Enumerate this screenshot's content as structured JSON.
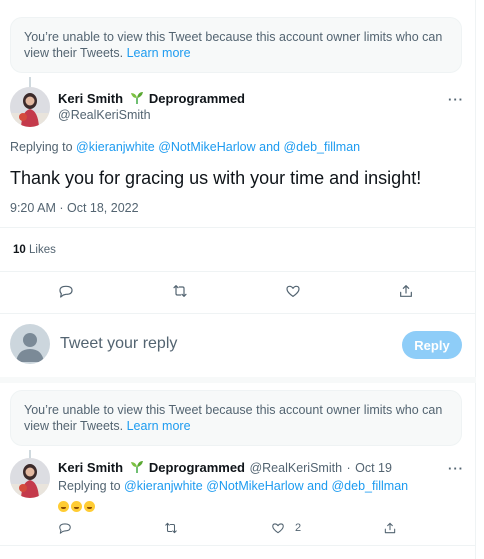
{
  "top_notice": {
    "text": "You’re unable to view this Tweet because this account owner limits who can view their Tweets.",
    "link": "Learn more"
  },
  "main_tweet": {
    "author_name": "Keri Smith",
    "author_suffix": "Deprogrammed",
    "handle": "@RealKeriSmith",
    "replying_prefix": "Replying to",
    "replying_users": [
      "@kieranjwhite",
      "@NotMikeHarlow",
      "and",
      "@deb_fillman"
    ],
    "text": "Thank you for gracing us with your time and insight!",
    "timestamp": "9:20 AM · Oct 18, 2022",
    "likes_count": "10",
    "likes_label": "Likes",
    "actions": [
      "reply-icon",
      "retweet-icon",
      "like-icon",
      "share-icon"
    ]
  },
  "composer": {
    "placeholder": "Tweet your reply",
    "button": "Reply"
  },
  "second_notice": {
    "text": "You’re unable to view this Tweet because this account owner limits who can view their Tweets.",
    "link": "Learn more"
  },
  "reply_tweet": {
    "author_name": "Keri Smith",
    "author_suffix": "Deprogrammed",
    "handle": "@RealKeriSmith",
    "time": "Oct 19",
    "replying_prefix": "Replying to",
    "replying_users": [
      "@kieranjwhite",
      "@NotMikeHarlow",
      "and",
      "@deb_fillman"
    ],
    "emoji_text": "🤣🤣🤣",
    "like_count": "2",
    "actions": [
      "reply-icon",
      "retweet-icon",
      "like-icon",
      "share-icon"
    ]
  },
  "colors": {
    "accent": "#1d9bf0",
    "muted": "#536471",
    "reply_button_disabled": "#8ecdf8"
  }
}
